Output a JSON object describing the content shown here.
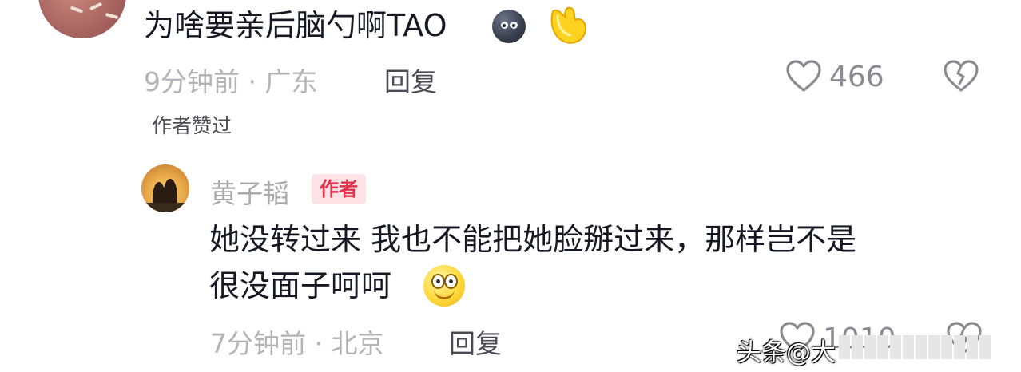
{
  "comments": [
    {
      "text": "为啥要亲后脑勺啊TAO",
      "emojis": [
        "dark-moon-face-emoji",
        "yellow-bicep-emoji"
      ],
      "time": "9分钟前",
      "location": "广东",
      "reply_label": "回复",
      "like_count": "466",
      "author_liked": "作者赞过"
    },
    {
      "username": "黄子韬",
      "badge": "作者",
      "text_line1": "她没转过来 我也不能把她脸掰过来，那样岂不是",
      "text_line2": "很没面子呵呵",
      "emojis": [
        "grinning-smile-emoji"
      ],
      "time": "7分钟前",
      "location": "北京",
      "reply_label": "回复",
      "like_count": "1010"
    }
  ],
  "separator": "·",
  "watermark": {
    "text": "头条@大"
  },
  "colors": {
    "text_primary": "#161823",
    "meta_gray": "#b3b3b8",
    "badge_red": "#e5314b",
    "badge_bg": "#fde2e6"
  }
}
